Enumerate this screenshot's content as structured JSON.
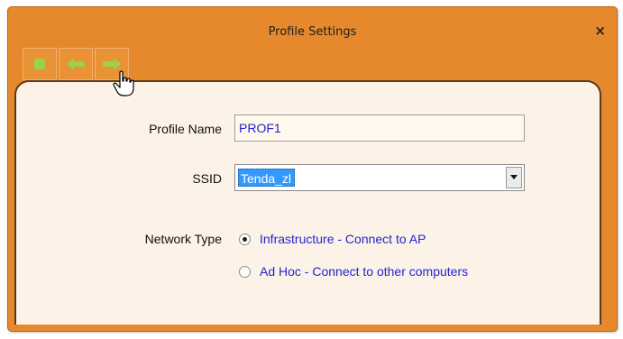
{
  "window": {
    "title": "Profile Settings",
    "close_label": "×"
  },
  "toolbar": {
    "buttons": [
      {
        "name": "stop",
        "icon": "green-square-icon"
      },
      {
        "name": "back",
        "icon": "arrow-left-icon"
      },
      {
        "name": "forward",
        "icon": "arrow-right-icon"
      }
    ],
    "icon_color": "#9ad04a"
  },
  "form": {
    "profile_name_label": "Profile Name",
    "profile_name_value": "PROF1",
    "ssid_label": "SSID",
    "ssid_value": "Tenda_zl",
    "network_type_label": "Network Type",
    "network_type_options": [
      {
        "label": "Infrastructure - Connect to AP",
        "selected": true
      },
      {
        "label": "Ad Hoc - Connect to other computers",
        "selected": false
      }
    ]
  },
  "colors": {
    "frame": "#e6892d",
    "panel": "#fcf2e7",
    "option_text": "#2424d0",
    "selection": "#3399ff"
  }
}
